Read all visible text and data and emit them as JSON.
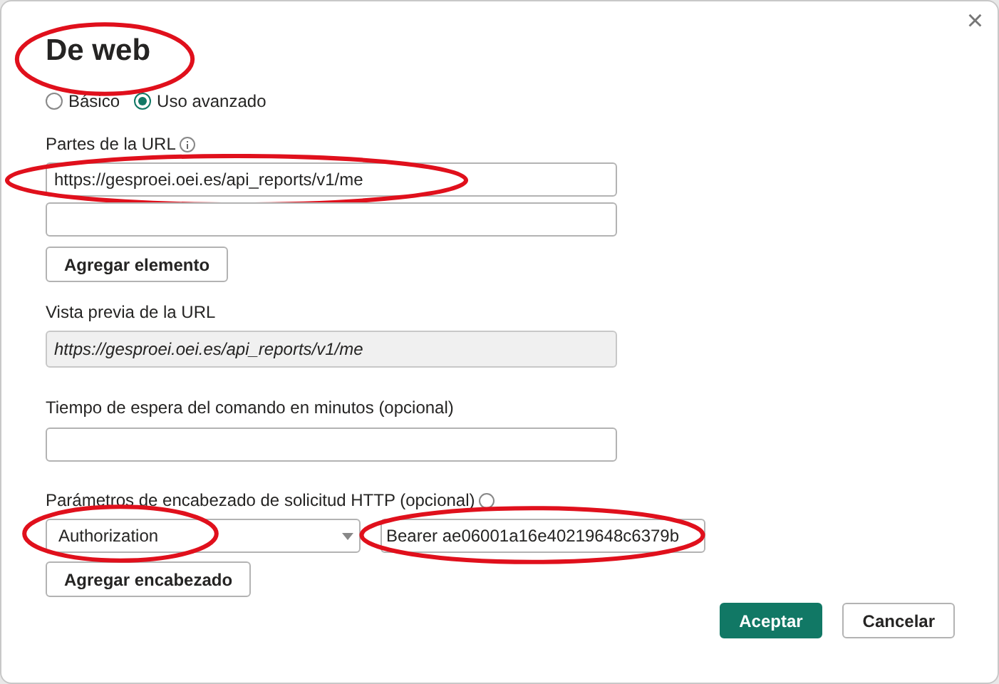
{
  "dialog": {
    "title": "De web",
    "title_circled": true,
    "close_label": "×"
  },
  "mode_options": [
    {
      "label": "Básico",
      "selected": false
    },
    {
      "label": "Uso avanzado",
      "selected": true
    }
  ],
  "url_parts": {
    "label": "Partes de la URL",
    "fields": [
      {
        "value": "https://gesproei.oei.es/api_reports/v1/me",
        "circled": true
      },
      {
        "circled": false
      }
    ],
    "add_button": "Agregar elemento"
  },
  "url_preview": {
    "label": "Vista previa de la URL",
    "value": "https://gesproei.oei.es/api_reports/v1/me"
  },
  "timeout": {
    "label": "Tiempo de espera del comando en minutos (opcional)"
  },
  "http_headers": {
    "label": "Parámetros de encabezado de solicitud HTTP (opcional)",
    "header_name": "Authorization",
    "header_name_circled": true,
    "header_value": "Bearer ae06001a16e40219648c6379b",
    "header_value_circled": true,
    "add_button": "Agregar encabezado"
  },
  "buttons": [
    {
      "label": "Aceptar",
      "kind": "primary"
    },
    {
      "label": "Cancelar",
      "kind": "secondary"
    }
  ]
}
